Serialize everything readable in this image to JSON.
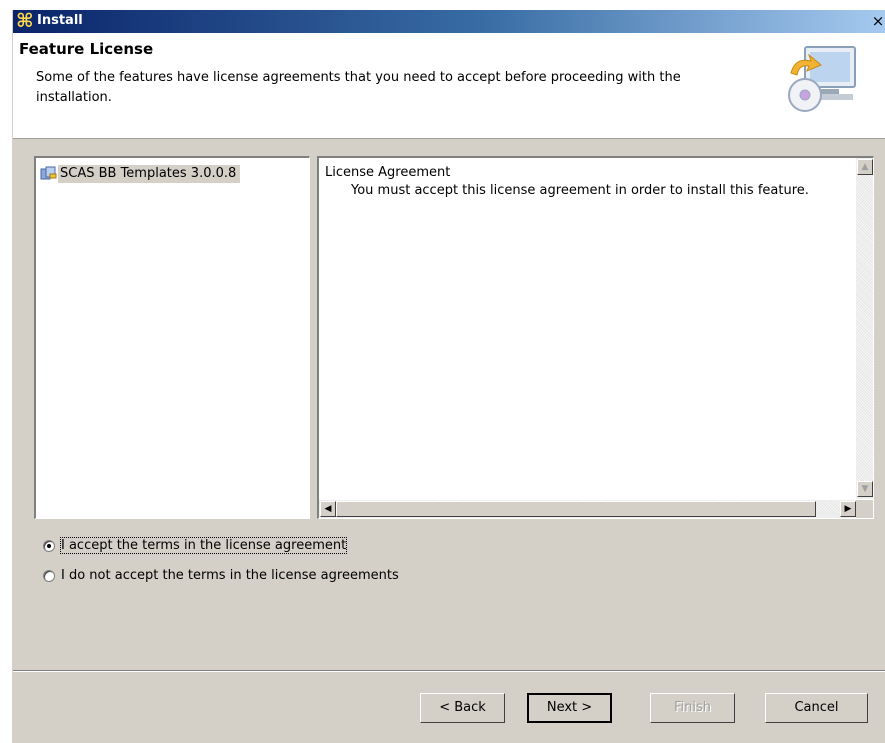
{
  "window": {
    "title": "Install",
    "close_label": "×"
  },
  "banner": {
    "title": "Feature License",
    "description": "Some of the features have license agreements that you need to accept before proceeding with the installation."
  },
  "features": [
    {
      "label": "SCAS BB Templates 3.0.0.8",
      "icon": "feature-plugin-icon",
      "selected": true
    }
  ],
  "license": {
    "heading": "License Agreement",
    "body": "You must accept this license agreement in order to install this feature."
  },
  "options": {
    "accept_label": "I accept the terms in the license agreement",
    "decline_label": "I do not accept the terms in the license agreements",
    "selected": "accept"
  },
  "buttons": {
    "back": "< Back",
    "next": "Next >",
    "finish": "Finish",
    "cancel": "Cancel"
  },
  "colors": {
    "titlebar_start": "#0a246a",
    "titlebar_end": "#a6caf0",
    "dialog_bg": "#d4d0c8"
  }
}
